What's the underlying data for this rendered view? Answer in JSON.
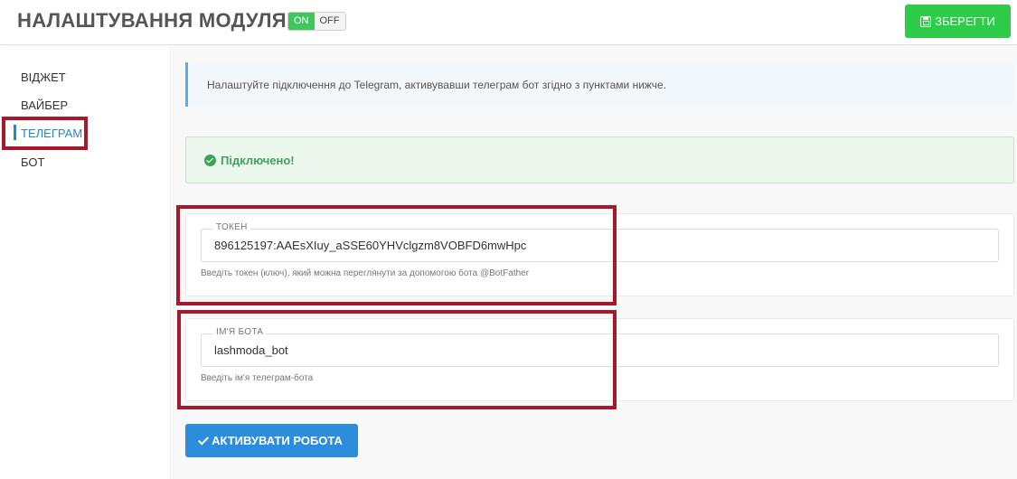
{
  "header": {
    "title": "НАЛАШТУВАННЯ МОДУЛЯ",
    "toggle_on": "ON",
    "toggle_off": "OFF",
    "save_label": "ЗБЕРЕГТИ",
    "save_color": "#2ecc49"
  },
  "sidebar": {
    "items": [
      {
        "label": "ВІДЖЕТ",
        "active": false
      },
      {
        "label": "ВАЙБЕР",
        "active": false
      },
      {
        "label": "ТЕЛЕГРАМ",
        "active": true
      },
      {
        "label": "БОТ",
        "active": false
      }
    ],
    "active_color": "#1f87d6"
  },
  "info": {
    "text": "Налаштуйте підключення до Telegram, активувавши телеграм бот згідно з пунктами нижче."
  },
  "status": {
    "text": "Підключено!",
    "color": "#3da35a"
  },
  "token_field": {
    "label": "ТОКЕН",
    "value": "896125197:AAEsXIuy_aSSE60YHVclgzm8VOBFD6mwHpc",
    "help": "Введіть токен (ключ), який можна переглянути за допомогою бота @BotFather"
  },
  "botname_field": {
    "label": "ІМ'Я БОТА",
    "value": "lashmoda_bot",
    "help": "Введіть ім'я телеграм-бота"
  },
  "activate_button": {
    "label": "АКТИВУВАТИ РОБОТА",
    "color": "#2b8ddb"
  },
  "highlight_color": "#a7192a"
}
